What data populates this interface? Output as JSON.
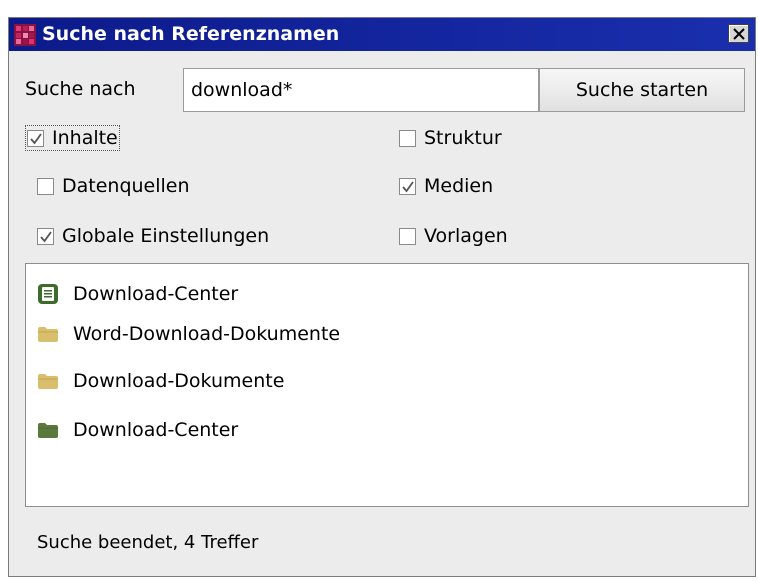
{
  "window": {
    "title": "Suche nach Referenznamen",
    "close_glyph": "✕"
  },
  "search": {
    "label": "Suche nach",
    "value": "download*",
    "button_label": "Suche starten"
  },
  "filters": [
    {
      "label": "Inhalte",
      "checked": true
    },
    {
      "label": "Struktur",
      "checked": false
    },
    {
      "label": "Datenquellen",
      "checked": false
    },
    {
      "label": "Medien",
      "checked": true
    },
    {
      "label": "Globale Einstellungen",
      "checked": true
    },
    {
      "label": "Vorlagen",
      "checked": false
    }
  ],
  "results": [
    {
      "label": "Download-Center",
      "icon": "page-icon",
      "color": "#3c6b2a"
    },
    {
      "label": "Word-Download-Dokumente",
      "icon": "folder-icon",
      "color": "#d9bf6d"
    },
    {
      "label": "Download-Dokumente",
      "icon": "folder-icon",
      "color": "#d9bf6d"
    },
    {
      "label": "Download-Center",
      "icon": "folder-icon",
      "color": "#5a7a3c"
    }
  ],
  "status": {
    "text": "Suche beendet, 4 Treffer"
  }
}
